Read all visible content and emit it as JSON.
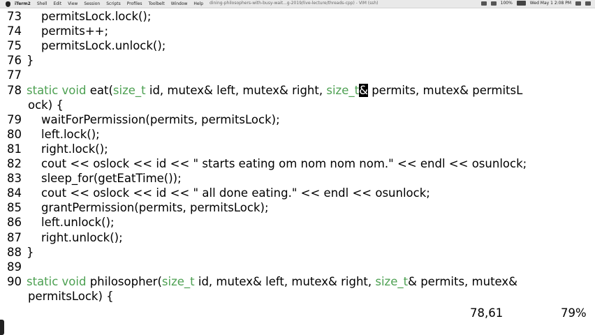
{
  "menubar": {
    "app_name": "iTerm2",
    "items": [
      "Shell",
      "Edit",
      "View",
      "Session",
      "Scripts",
      "Profiles",
      "Toolbelt",
      "Window",
      "Help"
    ],
    "window_title": "dining-philosophers-with-busy-wait...g-2019/live-lecture/threads-cpp) - VIM (ssh)",
    "battery_percent": "100%",
    "clock": "Wed May 1  2:08 PM"
  },
  "editor": {
    "lines": [
      {
        "num": "73",
        "segments": [
          {
            "t": "    permitsLock.lock();"
          }
        ]
      },
      {
        "num": "74",
        "segments": [
          {
            "t": "    permits++;"
          }
        ]
      },
      {
        "num": "75",
        "segments": [
          {
            "t": "    permitsLock.unlock();"
          }
        ]
      },
      {
        "num": "76",
        "segments": [
          {
            "t": "}"
          }
        ]
      },
      {
        "num": "77",
        "segments": []
      },
      {
        "num": "78",
        "segments": [
          {
            "t": "static void",
            "k": "kw"
          },
          {
            "t": " eat("
          },
          {
            "t": "size_t",
            "k": "kw"
          },
          {
            "t": " id, mutex& left, mutex& right, "
          },
          {
            "t": "size_t",
            "k": "kw"
          },
          {
            "t": "&",
            "k": "cursor"
          },
          {
            "t": " permits, mutex& permitsL"
          }
        ]
      },
      {
        "num": "",
        "segments": [
          {
            "t": "ock) {"
          }
        ]
      },
      {
        "num": "79",
        "segments": [
          {
            "t": "    waitForPermission(permits, permitsLock);"
          }
        ]
      },
      {
        "num": "80",
        "segments": [
          {
            "t": "    left.lock();"
          }
        ]
      },
      {
        "num": "81",
        "segments": [
          {
            "t": "    right.lock();"
          }
        ]
      },
      {
        "num": "82",
        "segments": [
          {
            "t": "    cout << oslock << id << \" starts eating om nom nom nom.\" << endl << osunlock;"
          }
        ]
      },
      {
        "num": "83",
        "segments": [
          {
            "t": "    sleep_for(getEatTime());"
          }
        ]
      },
      {
        "num": "84",
        "segments": [
          {
            "t": "    cout << oslock << id << \" all done eating.\" << endl << osunlock;"
          }
        ]
      },
      {
        "num": "85",
        "segments": [
          {
            "t": "    grantPermission(permits, permitsLock);"
          }
        ]
      },
      {
        "num": "86",
        "segments": [
          {
            "t": "    left.unlock();"
          }
        ]
      },
      {
        "num": "87",
        "segments": [
          {
            "t": "    right.unlock();"
          }
        ]
      },
      {
        "num": "88",
        "segments": [
          {
            "t": "}"
          }
        ]
      },
      {
        "num": "89",
        "segments": []
      },
      {
        "num": "90",
        "segments": [
          {
            "t": "static void",
            "k": "kw"
          },
          {
            "t": " philosopher("
          },
          {
            "t": "size_t",
            "k": "kw"
          },
          {
            "t": " id, mutex& left, mutex& right, "
          },
          {
            "t": "size_t",
            "k": "kw"
          },
          {
            "t": "& permits, mutex&"
          }
        ]
      },
      {
        "num": "",
        "segments": [
          {
            "t": "permitsLock) {"
          }
        ]
      }
    ]
  },
  "statusline": {
    "cursor_position": "78,61",
    "scroll_percent": "79%"
  },
  "colors": {
    "keyword": "#4da052",
    "text": "#000000",
    "background": "#ffffff"
  }
}
